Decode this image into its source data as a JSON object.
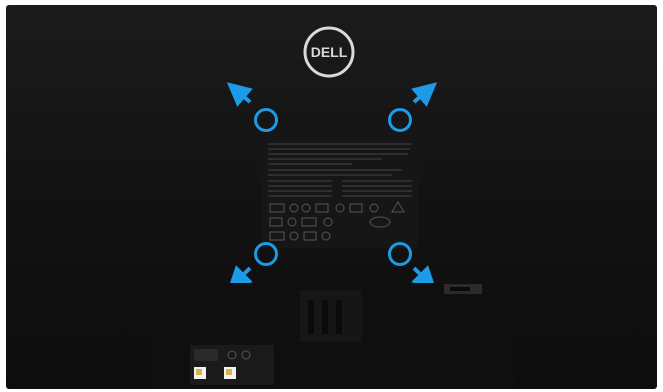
{
  "image": {
    "subject": "monitor-back-vesa-mount",
    "colors": {
      "monitor": "#141414",
      "accent_circles": "#1e9be8",
      "arrows": "#1e9be8",
      "logo": "#d9d9d9"
    }
  },
  "logo": {
    "text": "DELL"
  },
  "vesa": {
    "holes": [
      "top-left",
      "top-right",
      "bottom-left",
      "bottom-right"
    ],
    "arrows": [
      "up-left",
      "up-right",
      "down-left",
      "down-right"
    ]
  }
}
